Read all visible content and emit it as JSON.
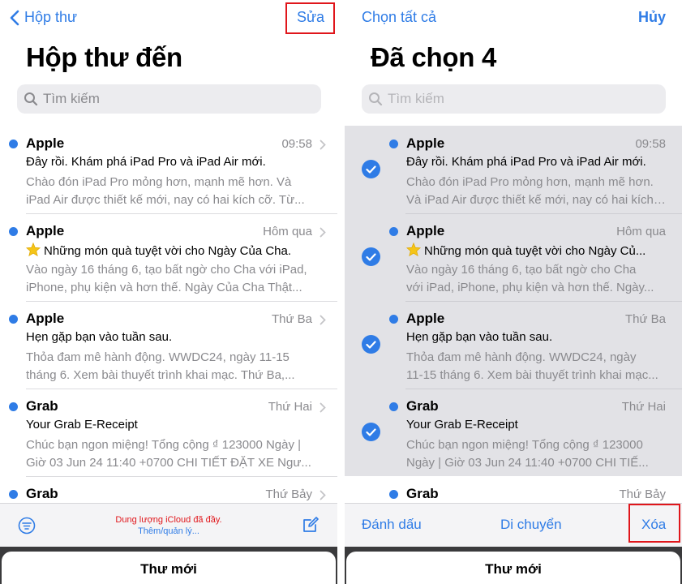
{
  "left": {
    "nav": {
      "back_label": "Hộp thư",
      "edit_label": "Sửa"
    },
    "title": "Hộp thư đến",
    "search": {
      "placeholder": "Tìm kiếm"
    },
    "messages": [
      {
        "sender": "Apple",
        "time": "09:58",
        "subject": "Đây rồi. Khám phá iPad Pro và iPad Air mới.",
        "preview1": "Chào đón iPad Pro mỏng hơn, mạnh mẽ hơn. Và",
        "preview2": "iPad Air được thiết kế mới, nay có hai kích cỡ. Từ..."
      },
      {
        "sender": "Apple",
        "time": "Hôm qua",
        "subject": "Những món quà tuyệt vời cho Ngày Của Cha.",
        "preview1": "Vào ngày 16 tháng 6, tạo bất ngờ cho Cha với iPad,",
        "preview2": "iPhone, phụ kiện và hơn thế. Ngày Của Cha Thật..."
      },
      {
        "sender": "Apple",
        "time": "Thứ Ba",
        "subject": "Hẹn gặp bạn vào tuần sau.",
        "preview1": "Thỏa đam mê hành động. WWDC24, ngày 11-15",
        "preview2": "tháng 6. Xem bài thuyết trình khai mạc. Thứ Ba,..."
      },
      {
        "sender": "Grab",
        "time": "Thứ Hai",
        "subject": "Your Grab E-Receipt",
        "preview1": "Chúc bạn ngon miệng! Tổng cộng ₫ 123000 Ngày |",
        "preview2": "Giờ 03 Jun 24 11:40 +0700 CHI TIẾT ĐẶT XE Ngư..."
      },
      {
        "sender": "Grab",
        "time": "Thứ Bảy"
      }
    ],
    "toolbar": {
      "status_warning": "Dung lượng iCloud đã đầy.",
      "status_manage": "Thêm/quản lý..."
    },
    "sheet_title": "Thư mới"
  },
  "right": {
    "nav": {
      "select_all_label": "Chọn tất cả",
      "cancel_label": "Hủy"
    },
    "title": "Đã chọn 4",
    "search": {
      "placeholder": "Tìm kiếm"
    },
    "messages": [
      {
        "sender": "Apple",
        "time": "09:58",
        "subject": "Đây rồi. Khám phá iPad Pro và iPad Air mới.",
        "preview1": "Chào đón iPad Pro mỏng hơn, mạnh mẽ hơn.",
        "preview2": "Và iPad Air được thiết kế mới, nay có hai kích cỡ..."
      },
      {
        "sender": "Apple",
        "time": "Hôm qua",
        "subject": "Những món quà tuyệt vời cho Ngày Củ...",
        "preview1": "Vào ngày 16 tháng 6, tạo bất ngờ cho Cha",
        "preview2": "với iPad, iPhone, phụ kiện và hơn thế. Ngày..."
      },
      {
        "sender": "Apple",
        "time": "Thứ Ba",
        "subject": "Hẹn gặp bạn vào tuần sau.",
        "preview1": "Thỏa đam mê hành động. WWDC24, ngày",
        "preview2": "11-15 tháng 6. Xem bài thuyết trình khai mạc..."
      },
      {
        "sender": "Grab",
        "time": "Thứ Hai",
        "subject": "Your Grab E-Receipt",
        "preview1": "Chúc bạn ngon miệng! Tổng cộng ₫ 123000",
        "preview2": "Ngày | Giờ 03 Jun 24 11:40 +0700 CHI TIẾ..."
      },
      {
        "sender": "Grab",
        "time": "Thứ Bảy"
      }
    ],
    "toolbar": {
      "mark_label": "Đánh dấu",
      "move_label": "Di chuyển",
      "delete_label": "Xóa"
    },
    "sheet_title": "Thư mới"
  },
  "colors": {
    "accent": "#2f7ce6",
    "highlight": "#e0161b",
    "selected_bg": "#e2e2e6"
  }
}
